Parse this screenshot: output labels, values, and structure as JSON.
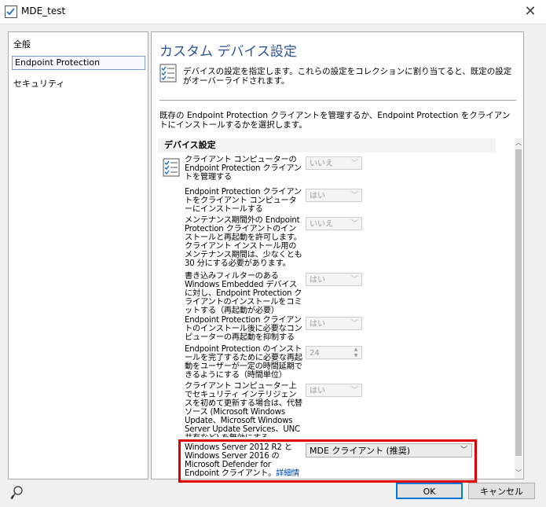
{
  "window": {
    "title": "MDE_test",
    "close_glyph": "✕"
  },
  "nav": {
    "items": [
      {
        "label": "全般",
        "selected": false
      },
      {
        "label": "Endpoint Protection",
        "selected": true
      },
      {
        "label": "セキュリティ",
        "selected": false
      }
    ]
  },
  "page": {
    "heading": "カスタム デバイス設定",
    "description": "デバイスの設定を指定します。これらの設定をコレクションに割り当てると、既定の設定がオーバーライドされます。",
    "intro": "既存の Endpoint Protection クライアントを管理するか、Endpoint Protection をクライアントにインストールするかを選択します。"
  },
  "settings": {
    "section_title": "デバイス設定",
    "rows": [
      {
        "label": "クライアント コンピューターの Endpoint Protection クライアントを管理する",
        "value": "いいえ",
        "control": "combo"
      },
      {
        "label": "Endpoint Protection クライアントをクライアント コンピューターにインストールする",
        "value": "はい",
        "control": "combo"
      },
      {
        "label": "メンテナンス期間外の Endpoint Protection クライアントのインストールと再起動を許可します。クライアント インストール用のメンテナンス期間は、少なくとも 30 分にする必要があります。",
        "value": "いいえ",
        "control": "combo"
      },
      {
        "label": "書き込みフィルターのある Windows Embedded デバイスに対し、Endpoint Protection クライアントのインストールをコミットする（再起動が必要）",
        "value": "はい",
        "control": "combo"
      },
      {
        "label": "Endpoint Protection クライアントのインストール後に必要なコンピューターの再起動を抑制する",
        "value": "はい",
        "control": "combo"
      },
      {
        "label": "Endpoint Protection のインストールを完了するために必要な再起動をユーザーが一定の時間延期できるようにする（時間単位）",
        "value": "24",
        "control": "spin"
      },
      {
        "label": "クライアント コンピューター上でセキュリティ インテリジェンスを初めて更新する場合は、代替ソース (Microsoft Windows Update、Microsoft Windows Server Update Services、UNC 共有など) を無効にする",
        "value": "はい",
        "control": "combo"
      }
    ],
    "highlighted": {
      "label": "Windows Server 2012 R2 と Windows Server 2016 の Microsoft Defender for Endpoint クライアント。",
      "link": "詳細情報",
      "value": "MDE クライアント (推奨)"
    }
  },
  "buttons": {
    "ok": "OK",
    "cancel": "キャンセル"
  },
  "colors": {
    "highlight_border": "#e00000",
    "heading": "#2f5496",
    "link": "#0046ad"
  },
  "icons": [
    "window-app-icon",
    "close-icon",
    "settings-list-icon",
    "status-user-icon"
  ]
}
